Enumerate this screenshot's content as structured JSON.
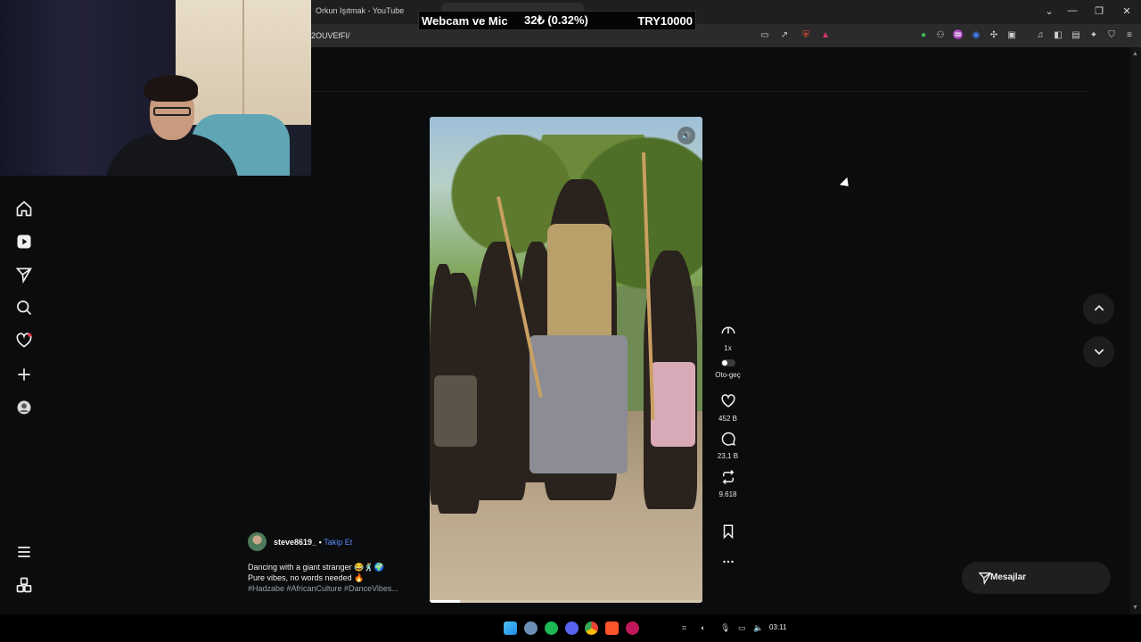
{
  "browser": {
    "window_title": "Orkun Işıtmak - YouTube",
    "url_fragment": "2OUVEfFI/",
    "window_controls": {
      "chevron": "⌄",
      "minimize": "—",
      "maximize": "❐",
      "close": "✕"
    }
  },
  "stream_overlay": {
    "label": "Webcam ve Mic",
    "amount": "32₺ (0.32%)",
    "goal": "TRY10000"
  },
  "post": {
    "username": "steve8619_",
    "separator": "•",
    "follow_label": "Takip Et",
    "caption_line1": "Dancing with a giant stranger 😂🕺🌍",
    "caption_line2": "Pure vibes, no words needed 🔥",
    "hashtags": "#Hadzabe #AfricanCulture #DanceVibes...",
    "progress": 0.11
  },
  "actions": {
    "speed_label": "1x",
    "autoplay_label": "Oto-geç",
    "likes": "452 B",
    "comments": "23,1 B",
    "reposts": "9.618"
  },
  "messages": {
    "label": "Mesajlar"
  },
  "taskbar": {
    "time": "03:11"
  },
  "colors": {
    "page_bg": "#0b0c0d",
    "follow_link": "#5b8cff",
    "notification_dot": "#ff3040"
  }
}
